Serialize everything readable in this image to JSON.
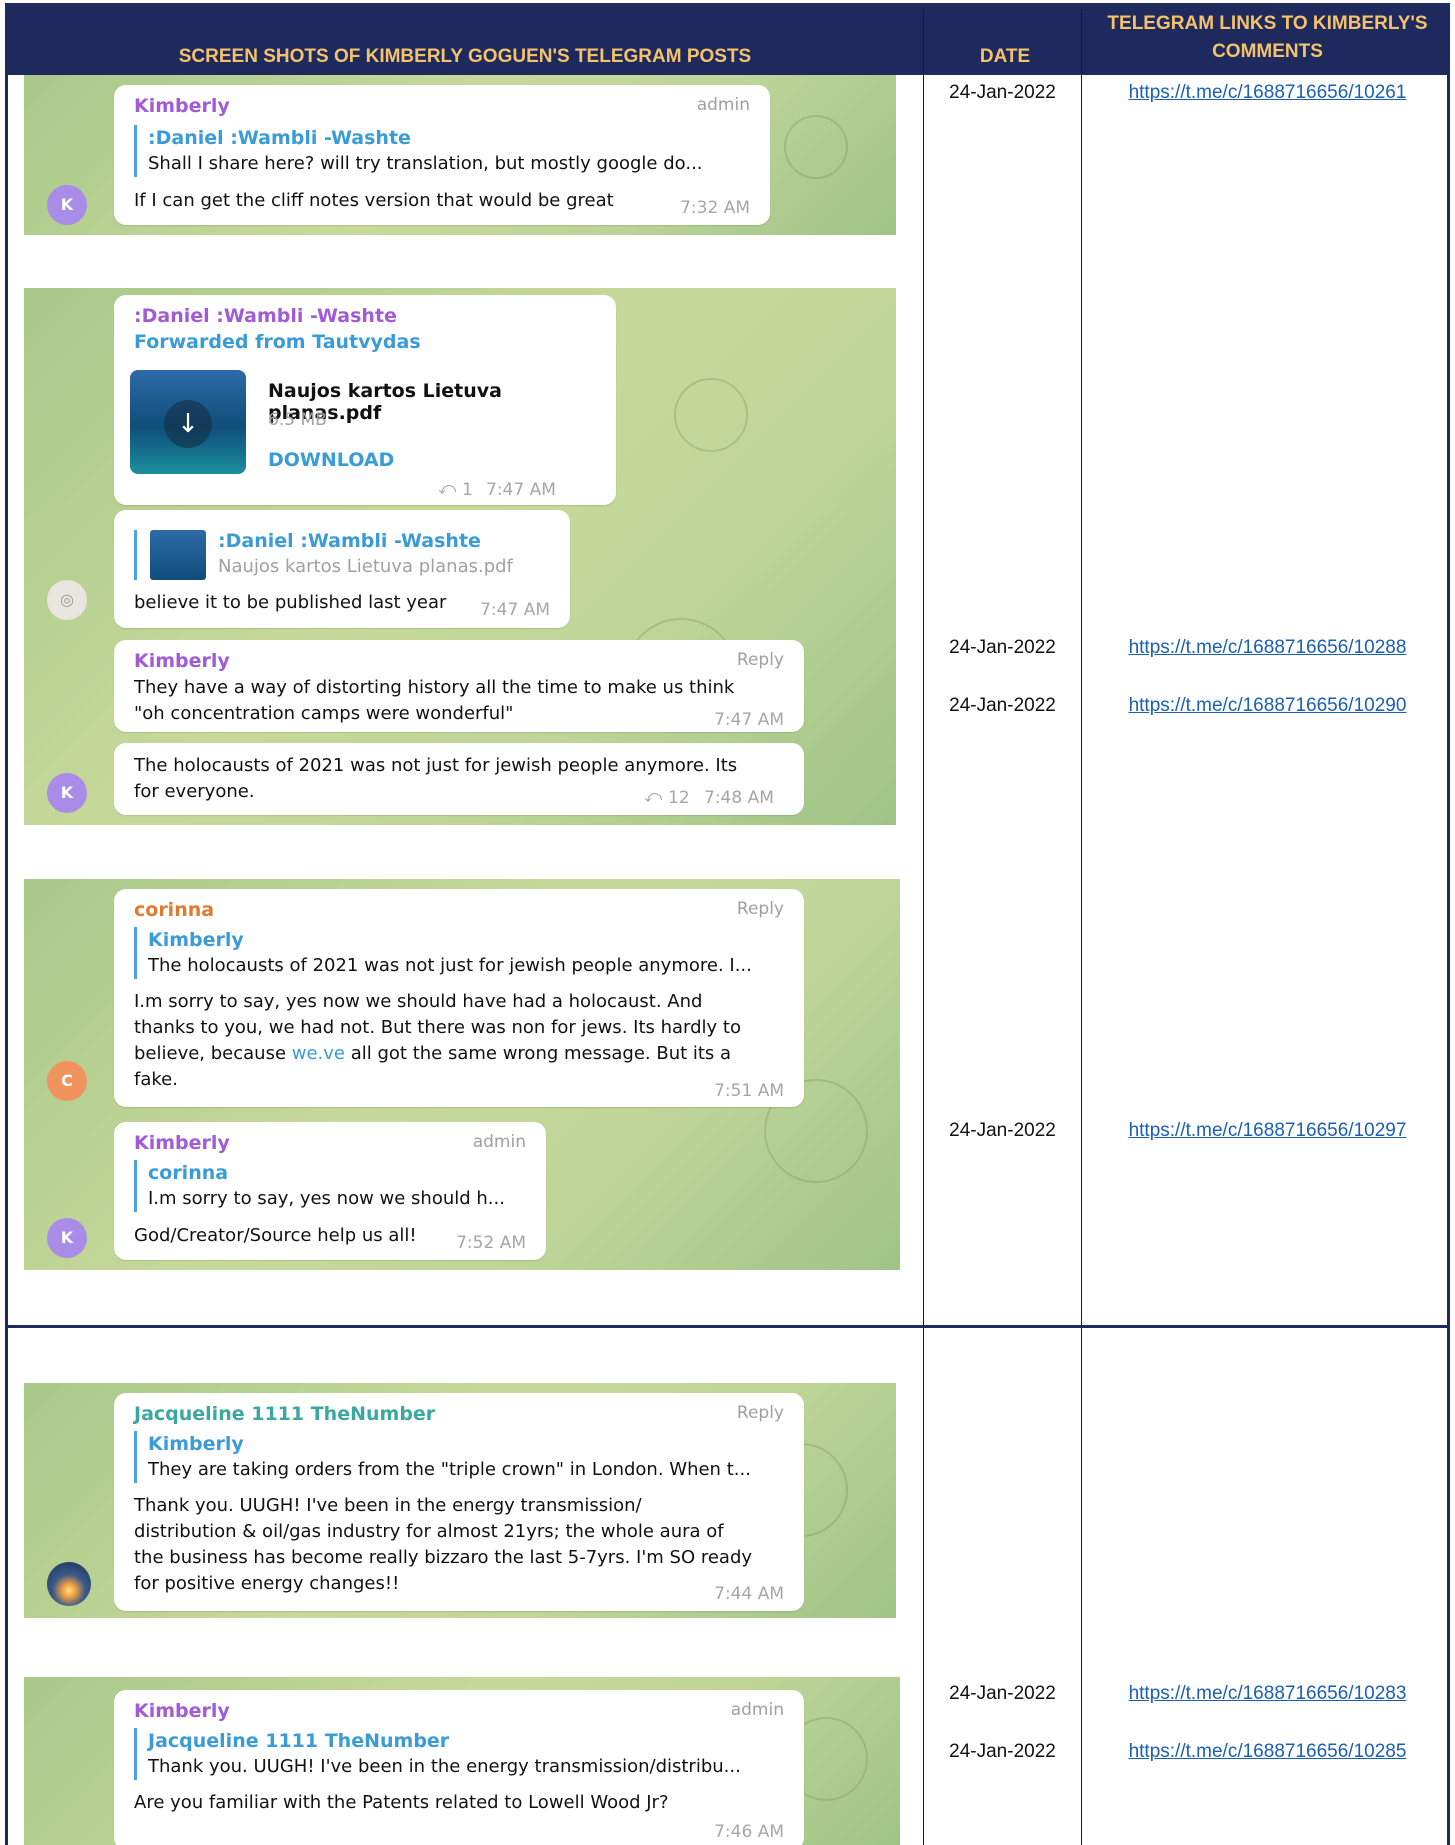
{
  "header": {
    "col1": "SCREEN SHOTS OF KIMBERLY GOGUEN'S TELEGRAM POSTS",
    "col2": "DATE",
    "col3_line1": "TELEGRAM LINKS TO KIMBERLY'S",
    "col3_line2": "COMMENTS"
  },
  "colors": {
    "header_bg": "#1e2a5e",
    "header_text": "#f5c26b",
    "link": "#1a5fb4"
  },
  "rows": [
    {
      "date": "24-Jan-2022",
      "link": "https://t.me/c/1688716656/10261"
    },
    {
      "date": "24-Jan-2022",
      "link": "https://t.me/c/1688716656/10288"
    },
    {
      "date": "24-Jan-2022",
      "link": "https://t.me/c/1688716656/10290"
    },
    {
      "date": "24-Jan-2022",
      "link": "https://t.me/c/1688716656/10297"
    },
    {
      "date": "24-Jan-2022",
      "link": "https://t.me/c/1688716656/10283"
    },
    {
      "date": "24-Jan-2022",
      "link": "https://t.me/c/1688716656/10285"
    }
  ],
  "shot1": {
    "name": "Kimberly",
    "badge": "admin",
    "quote_name": ":Daniel :Wambli -Washte",
    "quote_text": "Shall I share here? will try translation, but mostly google do...",
    "text": "If I can get the cliff notes version that would be great",
    "time": "7:32 AM",
    "avatar": "K"
  },
  "shot2": {
    "msg1": {
      "name": ":Daniel :Wambli -Washte",
      "forward": "Forwarded from Tautvydas",
      "file_name": "Naujos kartos Lietuva planas.pdf",
      "file_size": "6.5 MB",
      "download": "DOWNLOAD",
      "reply_count": "1",
      "time": "7:47 AM"
    },
    "msg2": {
      "quote_name": ":Daniel :Wambli -Washte",
      "quote_text": "Naujos kartos Lietuva planas.pdf",
      "text": "believe it to be published last year",
      "time": "7:47 AM"
    },
    "msg3": {
      "name": "Kimberly",
      "badge": "Reply",
      "text_line1": "They have a way of distorting history all the time to make us think",
      "text_line2": "\"oh concentration camps were wonderful\"",
      "time": "7:47 AM"
    },
    "msg4": {
      "text_line1": "The holocausts of 2021 was not just for jewish people anymore. Its",
      "text_line2": "for everyone.",
      "reply_count": "12",
      "time": "7:48 AM",
      "avatar": "K"
    }
  },
  "shot3": {
    "msg1": {
      "name": "corinna",
      "badge": "Reply",
      "quote_name": "Kimberly",
      "quote_text": "The holocausts of 2021 was not just for jewish people anymore. I...",
      "line1": "I.m sorry to say, yes now we should have had a holocaust. And",
      "line2": "thanks to you, we had not. But there was non for jews. Its hardly to",
      "line3_a": "believe, because ",
      "line3_link": "we.ve",
      "line3_b": " all got the same wrong message. But its a",
      "line4": "fake.",
      "time": "7:51 AM",
      "avatar": "C"
    },
    "msg2": {
      "name": "Kimberly",
      "badge": "admin",
      "quote_name": "corinna",
      "quote_text": "I.m sorry to say, yes now we should h...",
      "text": "God/Creator/Source help us all!",
      "time": "7:52 AM",
      "avatar": "K"
    }
  },
  "shot4": {
    "name": "Jacqueline 1111 TheNumber",
    "badge": "Reply",
    "quote_name": "Kimberly",
    "quote_text": "They are taking orders from the \"triple crown\" in London. When t...",
    "line1": "Thank you.  UUGH! I've been in the energy transmission/",
    "line2": "distribution & oil/gas industry for almost 21yrs; the whole aura of",
    "line3": "the business has become really bizzaro the last 5-7yrs.  I'm SO ready",
    "line4": "for positive energy changes!!",
    "time": "7:44 AM"
  },
  "shot5": {
    "name": "Kimberly",
    "badge": "admin",
    "quote_name": "Jacqueline 1111 TheNumber",
    "quote_text": "Thank you.  UUGH! I've been in the energy transmission/distribu...",
    "text": "Are you familiar with the Patents related to Lowell Wood Jr?",
    "time": "7:46 AM"
  }
}
